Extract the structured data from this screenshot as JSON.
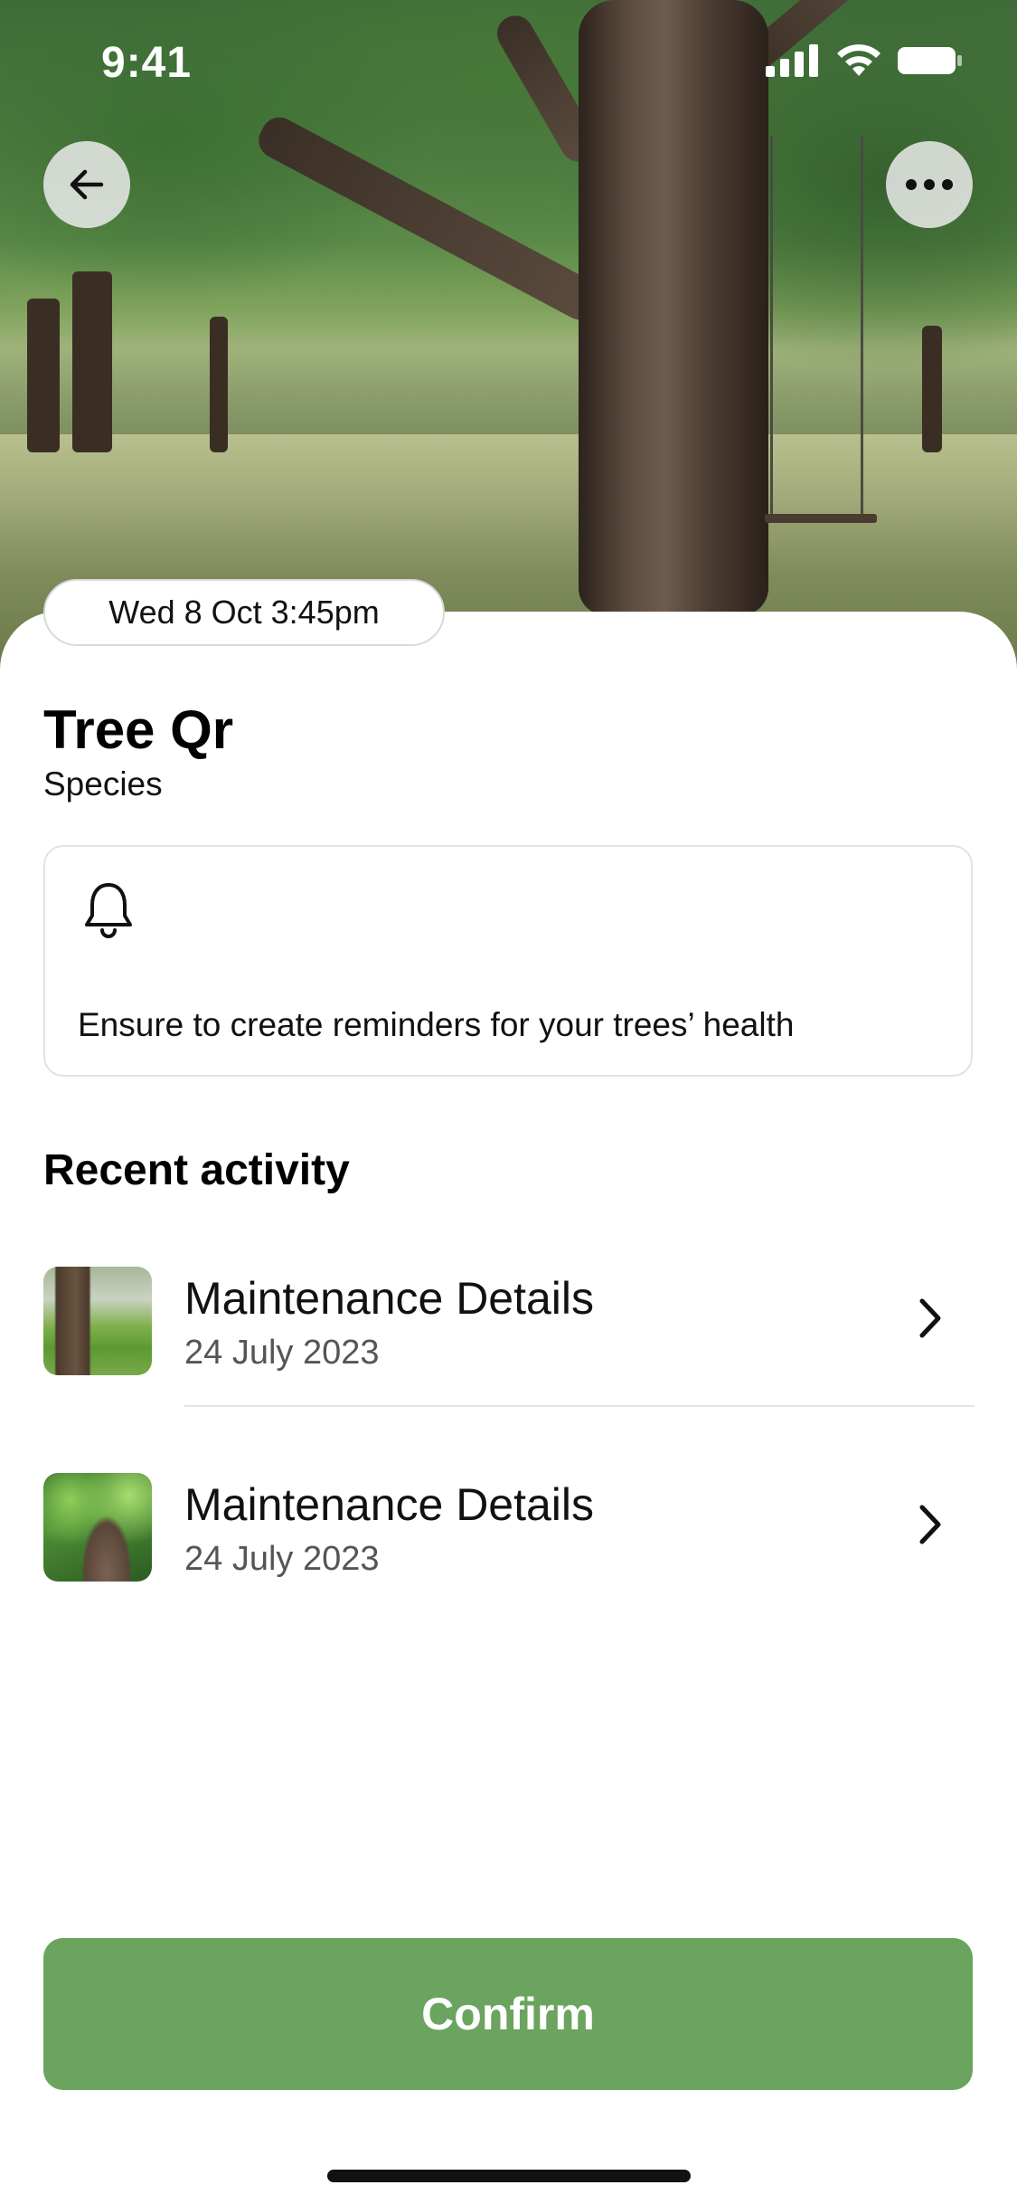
{
  "status_bar": {
    "time": "9:41"
  },
  "hero": {
    "back_icon": "arrow-left-icon",
    "more_icon": "ellipsis-icon"
  },
  "date_chip": "Wed 8 Oct 3:45pm",
  "tree": {
    "name": "Tree Qr",
    "subtitle": "Species"
  },
  "reminder": {
    "icon": "bell-icon",
    "text": "Ensure to create reminders for your trees’ health"
  },
  "recent": {
    "title": "Recent  activity",
    "items": [
      {
        "title": "Maintenance Details",
        "date": "24 July 2023"
      },
      {
        "title": "Maintenance Details",
        "date": "24 July 2023"
      }
    ]
  },
  "confirm_label": "Confirm",
  "colors": {
    "accent": "#6aa45e"
  }
}
